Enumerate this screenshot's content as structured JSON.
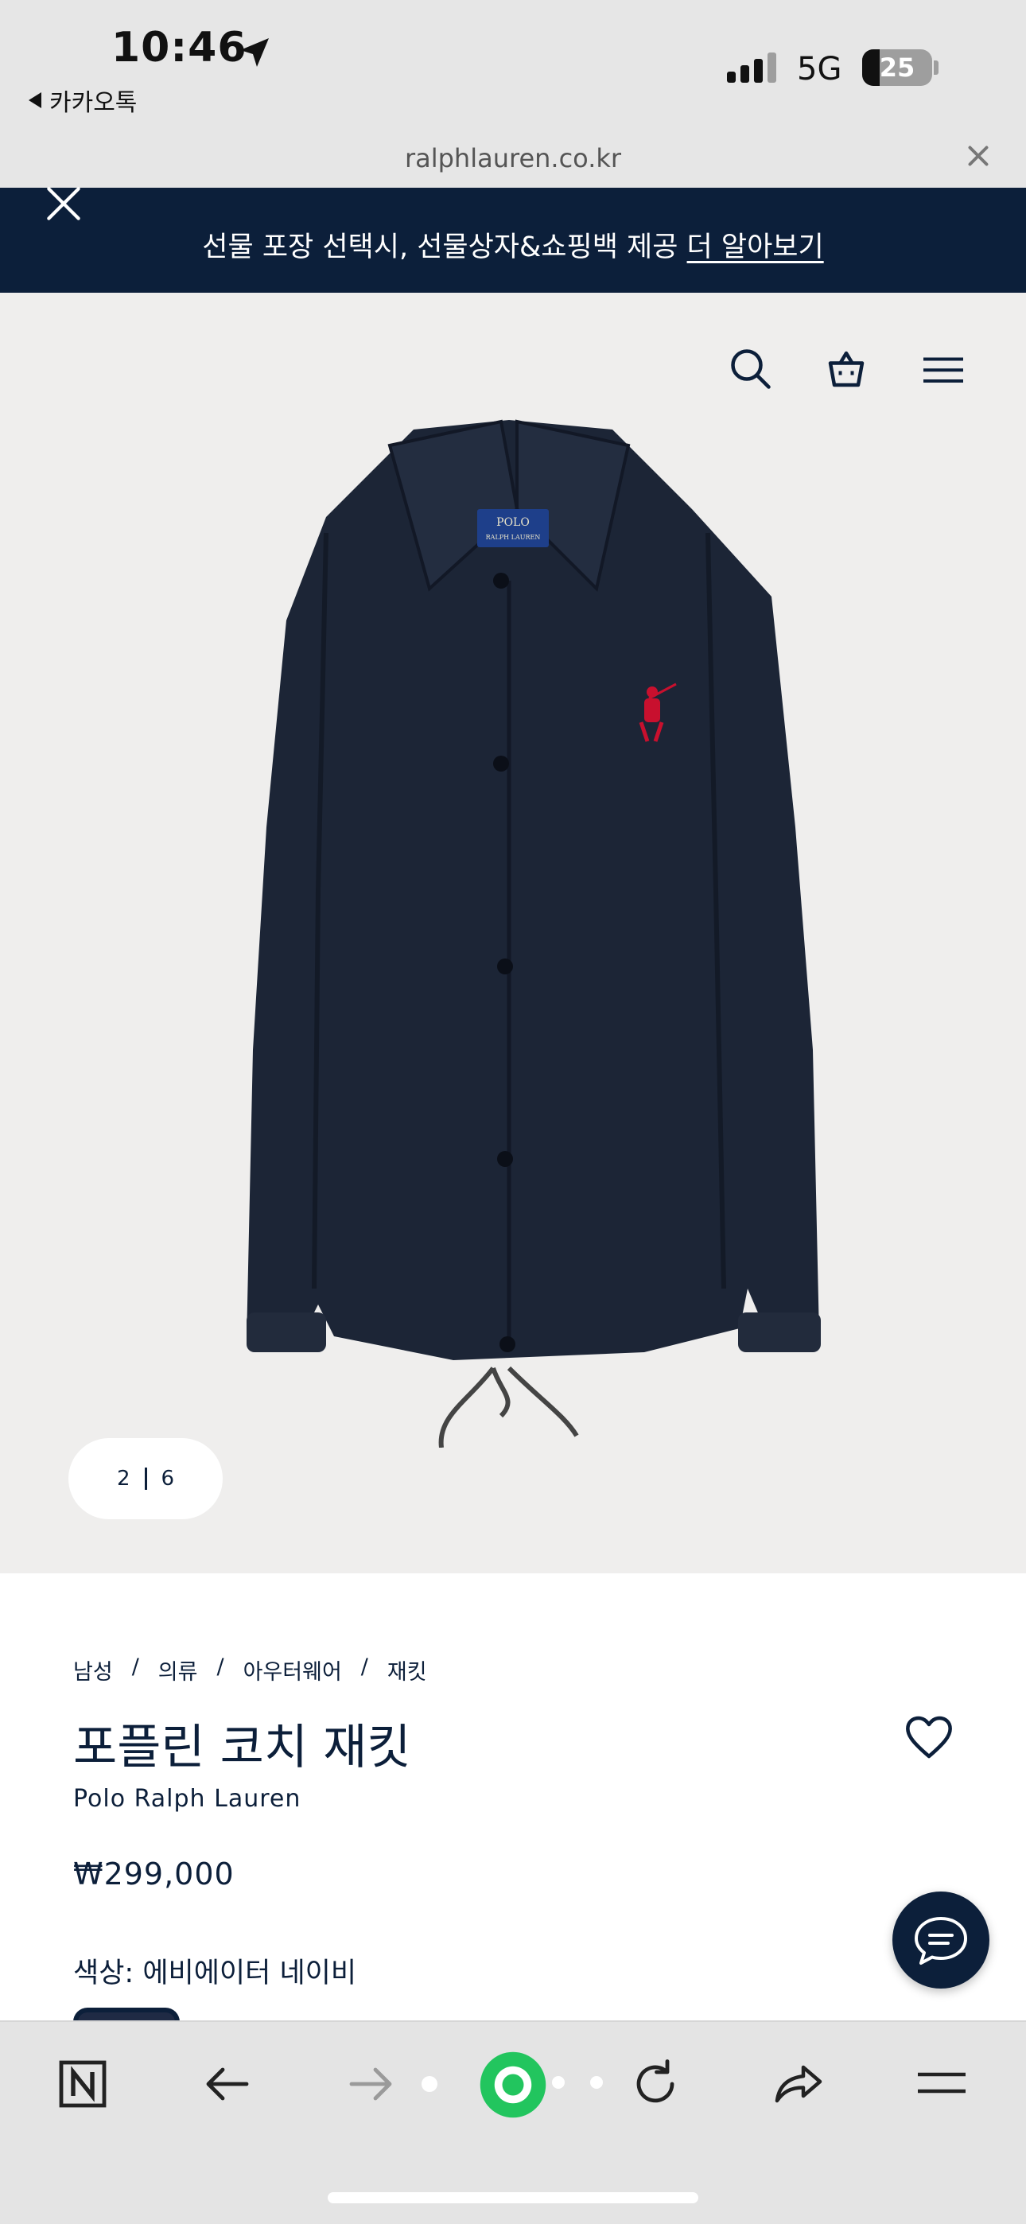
{
  "status_bar": {
    "time": "10:46",
    "back_app": "카카오톡",
    "network": "5G",
    "battery": "25",
    "battery_fraction": 0.25
  },
  "browser": {
    "url": "ralphlauren.co.kr"
  },
  "banner": {
    "text": "선물 포장 선택시, 선물상자&쇼핑백 제공 ",
    "link": "더 알아보기"
  },
  "gallery": {
    "current": "2",
    "total": "6"
  },
  "breadcrumb": [
    "남성",
    "의류",
    "아우터웨어",
    "재킷"
  ],
  "product": {
    "title": "포플린 코치 재킷",
    "brand": "Polo Ralph Lauren",
    "price": "₩299,000",
    "color_label": "색상: 에비에이터 네이비"
  },
  "label_text": {
    "line1": "POLO",
    "line2": "RALPH LAUREN"
  },
  "colors": {
    "navy": "#0c1f3a",
    "hero_bg": "#efeeed",
    "jacket": "#1c2536",
    "logo_red": "#c8102e",
    "toolbar_green": "#22c55e"
  },
  "icons": {
    "header": [
      "search-icon",
      "bag-icon",
      "menu-icon"
    ],
    "toolbar": [
      "naver-home-icon",
      "back-arrow-icon",
      "forward-arrow-icon",
      "green-dot-icon",
      "refresh-icon",
      "share-icon",
      "toolbar-menu-icon"
    ]
  }
}
